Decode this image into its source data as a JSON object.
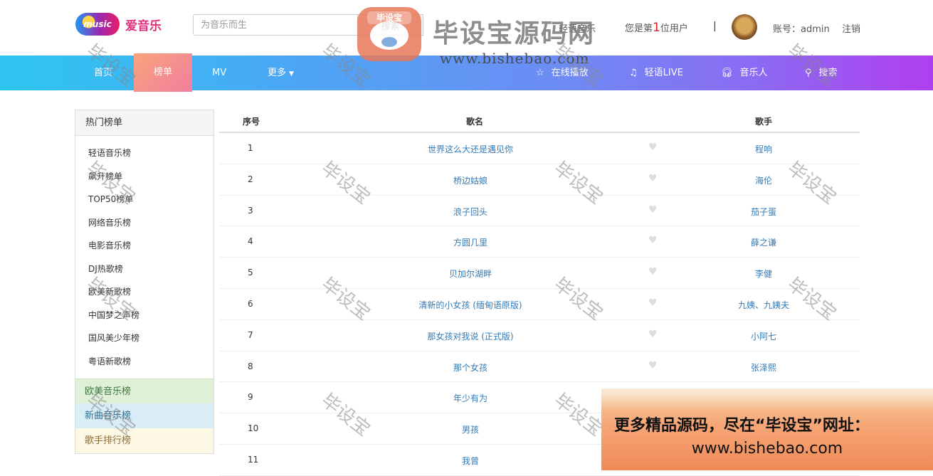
{
  "header": {
    "logo_badge": "music",
    "logo_text": "爱音乐",
    "search_placeholder": "为音乐而生",
    "search_button": "搜索",
    "note": "轻语音乐",
    "welcome_prefix": "您是第",
    "welcome_count": "1",
    "welcome_suffix": "位用户",
    "divider": "|",
    "account": "账号：admin",
    "logout": "注销"
  },
  "nav": {
    "items": [
      {
        "label": "首页"
      },
      {
        "label": "榜单"
      },
      {
        "label": "MV"
      },
      {
        "label": "更多"
      },
      {
        "label": "在线播放",
        "icon": "star-icon"
      },
      {
        "label": "轻语LIVE",
        "icon": "music-note-icon"
      },
      {
        "label": "音乐人",
        "icon": "headphones-icon"
      },
      {
        "label": "搜索",
        "icon": "search-icon"
      }
    ],
    "active": "榜单"
  },
  "sidebar": {
    "title": "热门榜单",
    "items": [
      "轻语音乐榜",
      "飙升榜单",
      "TOP50榜单",
      "网络音乐榜",
      "电影音乐榜",
      "DJ热歌榜",
      "欧美新歌榜",
      "中国梦之声榜",
      "国风美少年榜",
      "粤语新歌榜"
    ],
    "green": "欧美音乐榜",
    "blue": "新曲音乐榜",
    "yellow": "歌手排行榜"
  },
  "table": {
    "headers": {
      "no": "序号",
      "song": "歌名",
      "artist": "歌手"
    },
    "rows": [
      {
        "no": "1",
        "song": "世界这么大还是遇见你",
        "artist": "程响"
      },
      {
        "no": "2",
        "song": "桥边姑娘",
        "artist": "海伦"
      },
      {
        "no": "3",
        "song": "浪子回头",
        "artist": "茄子蛋"
      },
      {
        "no": "4",
        "song": "方圆几里",
        "artist": "薛之谦"
      },
      {
        "no": "5",
        "song": "贝加尔湖畔",
        "artist": "李健"
      },
      {
        "no": "6",
        "song": "清新的小女孩 (缅甸语原版)",
        "artist": "九姨、九姨夫"
      },
      {
        "no": "7",
        "song": "那女孩对我说 (正式版)",
        "artist": "小阿七"
      },
      {
        "no": "8",
        "song": "那个女孩",
        "artist": "张泽熙"
      },
      {
        "no": "9",
        "song": "年少有为",
        "artist": ""
      },
      {
        "no": "10",
        "song": "男孩",
        "artist": ""
      },
      {
        "no": "11",
        "song": "我曾",
        "artist": ""
      }
    ]
  },
  "watermark": {
    "title": "毕设宝源码网",
    "url": "www.bishebao.com",
    "logo_tag": "毕设宝",
    "diagonal": "毕设宝"
  },
  "ad": {
    "line1": "更多精品源码，尽在“毕设宝”网址：",
    "line2": "www.bishebao.com"
  }
}
